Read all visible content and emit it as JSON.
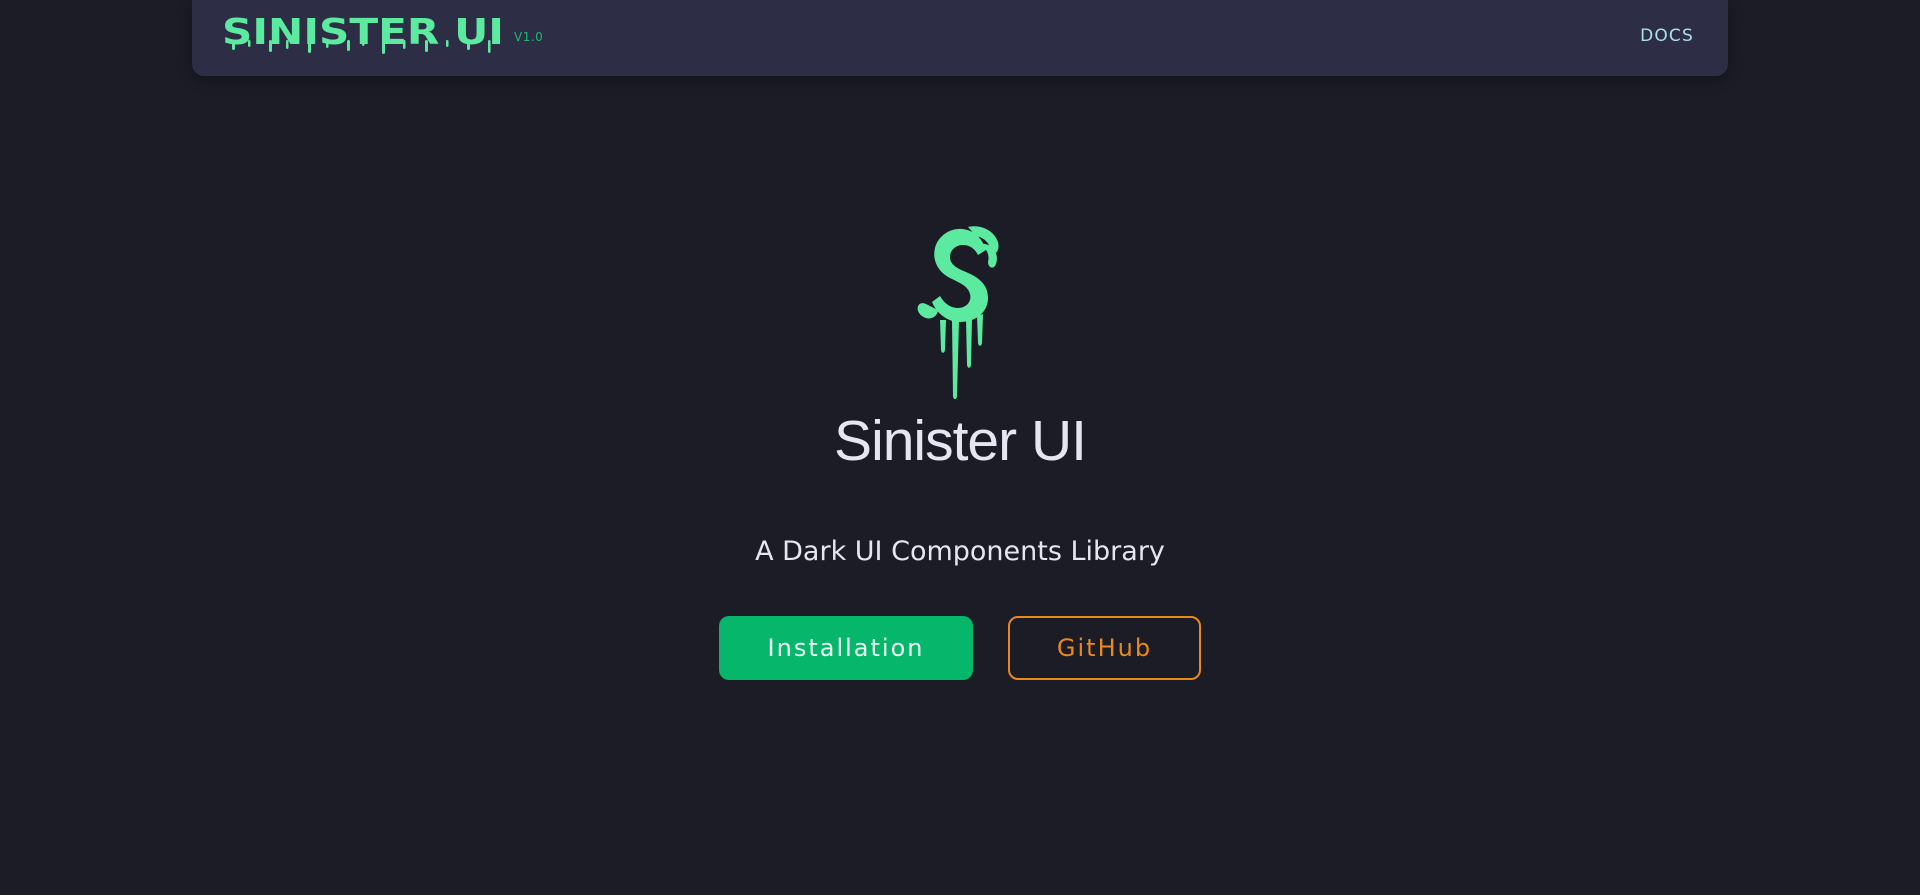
{
  "navbar": {
    "brand_name": "SINISTER UI",
    "version": "V1.0",
    "docs_label": "DOCS"
  },
  "hero": {
    "logo_icon": "dripping-s-icon",
    "title": "Sinister UI",
    "subtitle": "A Dark UI Components Library"
  },
  "buttons": {
    "installation_label": "Installation",
    "github_label": "GitHub"
  },
  "colors": {
    "background": "#1c1c27",
    "navbar": "#2d2d45",
    "brand_green": "#5ceaa0",
    "primary_button": "#06b66b",
    "accent_orange": "#e8891b",
    "docs_link": "#a9e1ef",
    "text": "#e6e6f2"
  }
}
